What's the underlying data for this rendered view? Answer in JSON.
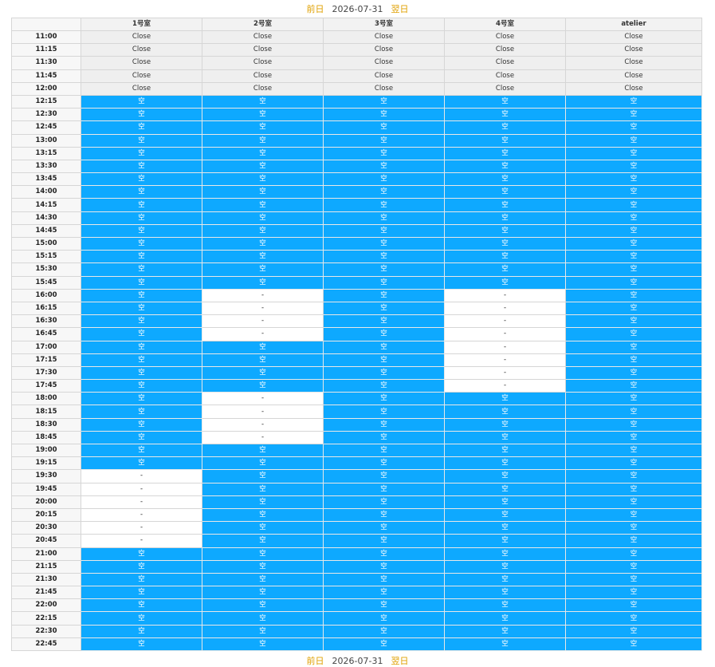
{
  "nav": {
    "prev_label": "前日",
    "date": "2026-07-31",
    "next_label": "翌日"
  },
  "columns": [
    "1号室",
    "2号室",
    "3号室",
    "4号室",
    "atelier"
  ],
  "times": [
    "11:00",
    "11:15",
    "11:30",
    "11:45",
    "12:00",
    "12:15",
    "12:30",
    "12:45",
    "13:00",
    "13:15",
    "13:30",
    "13:45",
    "14:00",
    "14:15",
    "14:30",
    "14:45",
    "15:00",
    "15:15",
    "15:30",
    "15:45",
    "16:00",
    "16:15",
    "16:30",
    "16:45",
    "17:00",
    "17:15",
    "17:30",
    "17:45",
    "18:00",
    "18:15",
    "18:30",
    "18:45",
    "19:00",
    "19:15",
    "19:30",
    "19:45",
    "20:00",
    "20:15",
    "20:30",
    "20:45",
    "21:00",
    "21:15",
    "21:30",
    "21:45",
    "22:00",
    "22:15",
    "22:30",
    "22:45"
  ],
  "status_labels": {
    "C": "Close",
    "A": "空",
    "B": "-"
  },
  "colors": {
    "available": "#0ea9ff",
    "closed": "#efefef",
    "booked": "#ffffff",
    "nav_link": "#e0a000"
  },
  "rows": [
    "CCCCC",
    "CCCCC",
    "CCCCC",
    "CCCCC",
    "CCCCC",
    "AAAAA",
    "AAAAA",
    "AAAAA",
    "AAAAA",
    "AAAAA",
    "AAAAA",
    "AAAAA",
    "AAAAA",
    "AAAAA",
    "AAAAA",
    "AAAAA",
    "AAAAA",
    "AAAAA",
    "AAAAA",
    "AAAAA",
    "ABABA",
    "ABABA",
    "ABABA",
    "ABABA",
    "AAABA",
    "AAABA",
    "AAABA",
    "AAABA",
    "ABAAA",
    "ABAAA",
    "ABAAA",
    "ABAAA",
    "AAAAA",
    "AAAAA",
    "BAAAA",
    "BAAAA",
    "BAAAA",
    "BAAAA",
    "BAAAA",
    "BAAAA",
    "AAAAA",
    "AAAAA",
    "AAAAA",
    "AAAAA",
    "AAAAA",
    "AAAAA",
    "AAAAA",
    "AAAAA"
  ]
}
